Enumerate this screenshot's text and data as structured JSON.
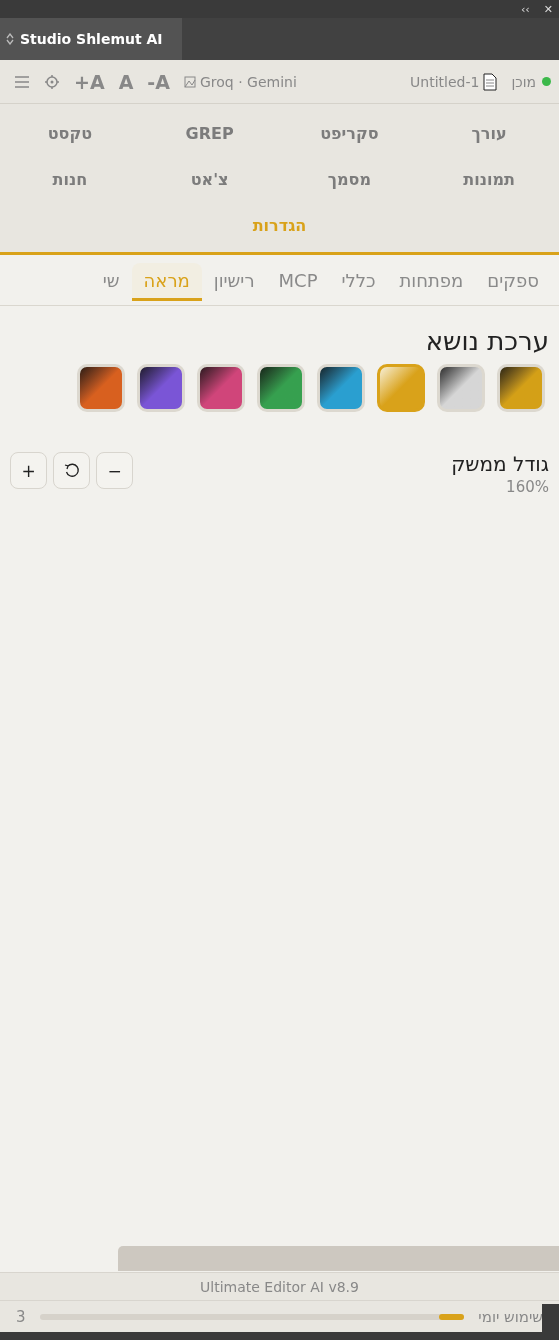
{
  "window": {
    "collapse_glyph": "‹‹",
    "close_glyph": "✕"
  },
  "panel_tab": {
    "label": "Studio Shlemut AI"
  },
  "toolbar": {
    "status": "מוכן",
    "document": "Untitled-1",
    "providers": "Groq · Gemini",
    "font_buttons": [
      "-A",
      "A",
      "+A"
    ]
  },
  "nav": [
    {
      "label": "עורך",
      "selected": false
    },
    {
      "label": "סקריפט",
      "selected": false
    },
    {
      "label": "GREP",
      "selected": false
    },
    {
      "label": "טקסט",
      "selected": false
    },
    {
      "label": "תמונות",
      "selected": false
    },
    {
      "label": "מסמך",
      "selected": false
    },
    {
      "label": "צ'אט",
      "selected": false
    },
    {
      "label": "חנות",
      "selected": false
    },
    {
      "label": "הגדרות",
      "selected": true
    }
  ],
  "subtabs": [
    {
      "label": "ספקים",
      "selected": false
    },
    {
      "label": "מפתחות",
      "selected": false
    },
    {
      "label": "כללי",
      "selected": false
    },
    {
      "label": "MCP",
      "selected": false
    },
    {
      "label": "רישיון",
      "selected": false
    },
    {
      "label": "מראה",
      "selected": true
    },
    {
      "label": "שי",
      "selected": false
    }
  ],
  "theme": {
    "title": "ערכת נושא",
    "swatches": [
      {
        "color": "#d4a017",
        "selected": false
      },
      {
        "color": "#d6d6d6",
        "selected": false
      },
      {
        "color": "#d9a21a",
        "selected": true
      },
      {
        "color": "#2a9fd0",
        "selected": false
      },
      {
        "color": "#36a04f",
        "selected": false
      },
      {
        "color": "#d0457a",
        "selected": false
      },
      {
        "color": "#7a55d6",
        "selected": false
      },
      {
        "color": "#d8601f",
        "selected": false
      }
    ]
  },
  "ui_size": {
    "label": "גודל ממשק",
    "value": "160%",
    "buttons": [
      "−",
      "+"
    ]
  },
  "footer": {
    "version": "Ultimate Editor AI v8.9"
  },
  "usage": {
    "label": "שימוש יומי",
    "level": 0.06,
    "count": "3"
  }
}
